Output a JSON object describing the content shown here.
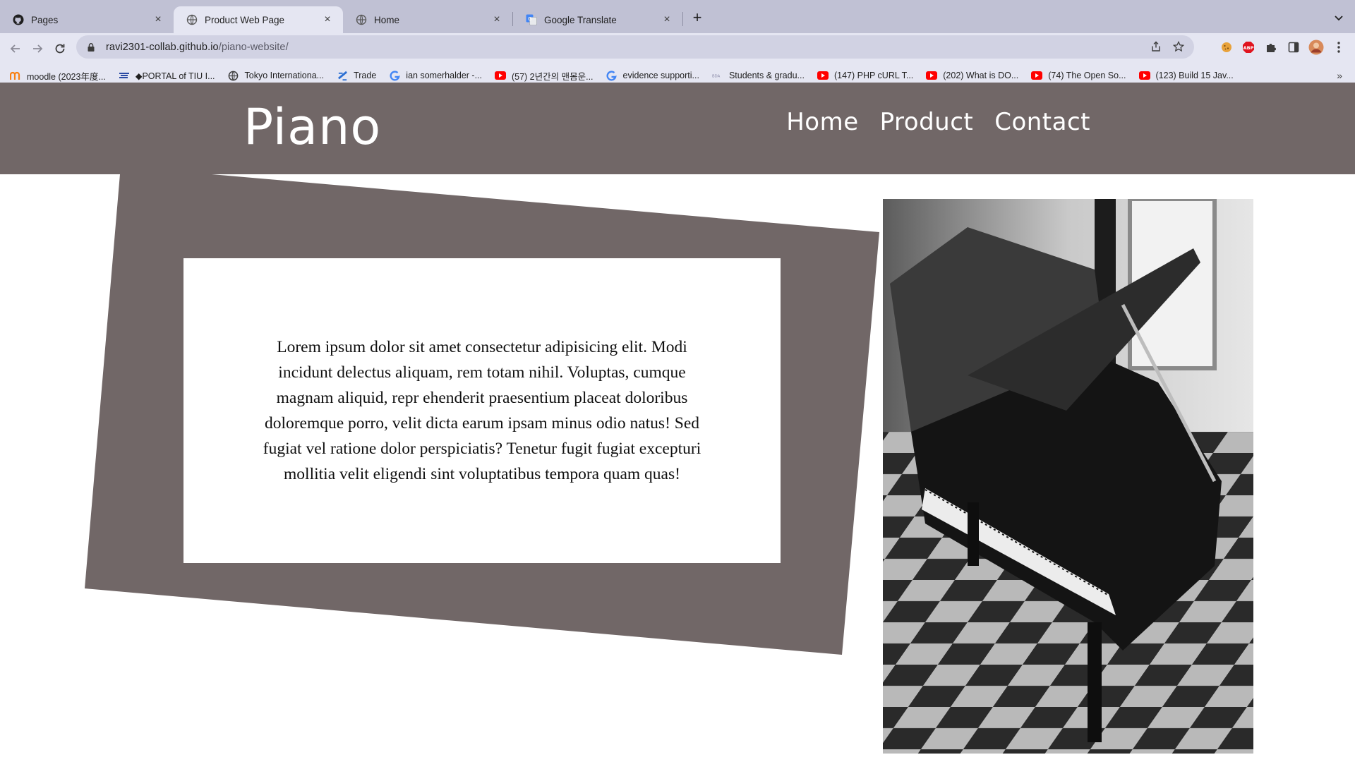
{
  "browser": {
    "tabs": [
      {
        "title": "Pages",
        "icon": "github-icon",
        "active": false
      },
      {
        "title": "Product Web Page",
        "icon": "globe-icon",
        "active": true
      },
      {
        "title": "Home",
        "icon": "globe-icon",
        "active": false
      },
      {
        "title": "Google Translate",
        "icon": "google-translate-icon",
        "active": false
      }
    ],
    "url_host": "ravi2301-collab.github.io",
    "url_path": "/piano-website/",
    "bookmarks": [
      {
        "label": "moodle (2023年度...",
        "icon": "moodle-icon"
      },
      {
        "label": "◆PORTAL of TIU I...",
        "icon": "tiu-icon"
      },
      {
        "label": "Tokyo Internationa...",
        "icon": "globe-icon"
      },
      {
        "label": "Trade",
        "icon": "trade-icon"
      },
      {
        "label": "ian somerhalder -...",
        "icon": "google-icon"
      },
      {
        "label": "(57) 2년간의 맨몸운...",
        "icon": "youtube-icon"
      },
      {
        "label": "evidence supporti...",
        "icon": "google-icon"
      },
      {
        "label": "Students & gradu...",
        "icon": "bda-icon"
      },
      {
        "label": "(147) PHP cURL T...",
        "icon": "youtube-icon"
      },
      {
        "label": "(202) What is DO...",
        "icon": "youtube-icon"
      },
      {
        "label": "(74) The Open So...",
        "icon": "youtube-icon"
      },
      {
        "label": "(123) Build 15 Jav...",
        "icon": "youtube-icon"
      }
    ],
    "bookmarks_overflow": "»"
  },
  "site": {
    "logo": "Piano",
    "nav": [
      "Home",
      "Product",
      "Contact"
    ],
    "card_text": "Lorem ipsum dolor sit amet consectetur adipisicing elit. Modi incidunt delectus aliquam, rem totam nihil. Voluptas, cumque magnam aliquid, repr ehenderit praesentium placeat doloribus doloremque porro, velit dicta earum ipsam minus odio natus! Sed fugiat vel ratione dolor perspiciatis? Tenetur fugit fugiat excepturi mollitia velit eligendi sint voluptatibus tempora quam quas!",
    "photo_subject": "grand-piano-photo"
  },
  "colors": {
    "brand_taupe": "#716767",
    "tabstrip": "#c0c1d4",
    "toolbar": "#e5e6f2"
  }
}
